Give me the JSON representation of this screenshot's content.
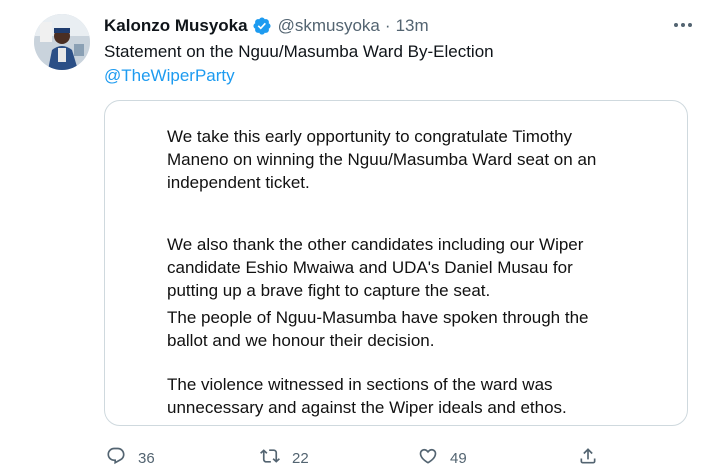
{
  "author": {
    "name": "Kalonzo Musyoka",
    "handle": "@skmusyoka",
    "separator": "·",
    "time": "13m"
  },
  "tweet": {
    "text": "Statement on the Nguu/Masumba Ward By-Election",
    "mention": "@TheWiperParty"
  },
  "statement": {
    "paragraphs": [
      [
        " We take this early opportunity to congratulate Timothy",
        "Maneno on winning the Nguu/Masumba Ward seat on an",
        "independent ticket."
      ],
      [
        "We also thank the other candidates including our Wiper",
        "candidate Eshio Mwaiwa and UDA's  Daniel Musau for",
        "putting up a brave fight to capture the seat."
      ],
      [
        "The people of Nguu-Masumba have spoken through the",
        "ballot and we honour their decision."
      ],
      [
        "The violence witnessed in sections of the ward was",
        "unnecessary and against the Wiper ideals and ethos."
      ]
    ]
  },
  "actions": {
    "replies": "36",
    "retweets": "22",
    "likes": "49"
  },
  "colors": {
    "accent": "#1d9bf0",
    "verified": "#1d9bf0",
    "secondary_text": "#536471"
  },
  "icons": {
    "verified": "verified-badge-icon",
    "more": "more-options-icon",
    "reply": "reply-icon",
    "retweet": "retweet-icon",
    "like": "heart-icon",
    "share": "share-icon"
  }
}
